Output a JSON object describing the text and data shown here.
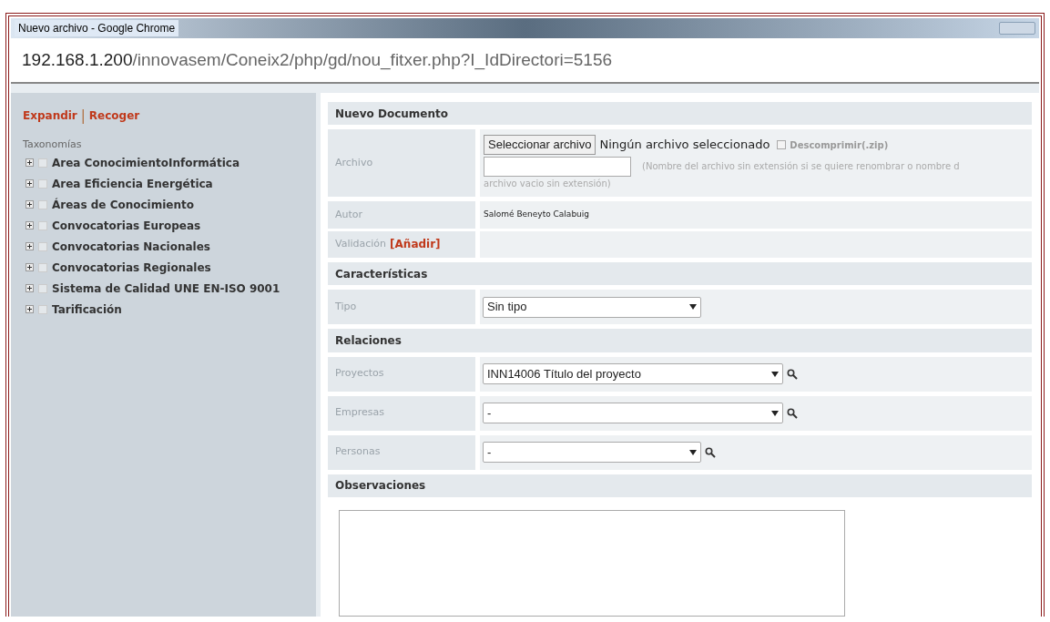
{
  "window": {
    "title": "Nuevo archivo - Google Chrome"
  },
  "address_bar": {
    "host": "192.168.1.200",
    "path": "/innovasem/Coneix2/php/gd/nou_fitxer.php?I_IdDirectori=5156"
  },
  "sidebar": {
    "links": [
      "Expandir",
      "Recoger"
    ],
    "separator": "|",
    "heading": "Taxonomías",
    "items": [
      {
        "label": "Area ConocimientoInformática",
        "checked": false,
        "expanded": false
      },
      {
        "label": "Area Eficiencia Energética",
        "checked": false,
        "expanded": false
      },
      {
        "label": "Áreas de Conocimiento",
        "checked": false,
        "expanded": false
      },
      {
        "label": "Convocatorias Europeas",
        "checked": false,
        "expanded": false
      },
      {
        "label": "Convocatorias Nacionales",
        "checked": false,
        "expanded": false
      },
      {
        "label": "Convocatorias Regionales",
        "checked": false,
        "expanded": false
      },
      {
        "label": "Sistema de Calidad UNE EN-ISO 9001",
        "checked": false,
        "expanded": false
      },
      {
        "label": "Tarificación",
        "checked": false,
        "expanded": false
      }
    ]
  },
  "form": [
    {
      "kind": "section",
      "label": "Nuevo Documento"
    },
    {
      "kind": "file",
      "label": "Archivo",
      "button": "Seleccionar archivo",
      "status": "Ningún archivo seleccionado",
      "unzip": {
        "label": "Descomprimir(.zip)",
        "checked": false
      },
      "hint": "(Nombre del archivo sin extensión si se quiere renombrar o nombre d",
      "hint_continued": "archivo vacio sin extensión)"
    },
    {
      "kind": "text",
      "label": "Autor",
      "value": "Salomé Beneyto Calabuig"
    },
    {
      "kind": "link",
      "label": "Validación",
      "link": "[Añadir]"
    },
    {
      "kind": "section",
      "label": "Características"
    },
    {
      "kind": "select",
      "label": "Tipo",
      "value": "Sin tipo",
      "search": false,
      "wide": false
    },
    {
      "kind": "section",
      "label": "Relaciones"
    },
    {
      "kind": "select",
      "label": "Proyectos",
      "value": "INN14006 Título del proyecto",
      "search": true,
      "wide": true
    },
    {
      "kind": "select",
      "label": "Empresas",
      "value": "-",
      "search": true,
      "wide": true
    },
    {
      "kind": "select",
      "label": "Personas",
      "value": "-",
      "search": true,
      "wide": false
    },
    {
      "kind": "section",
      "label": "Observaciones"
    },
    {
      "kind": "textarea"
    }
  ]
}
